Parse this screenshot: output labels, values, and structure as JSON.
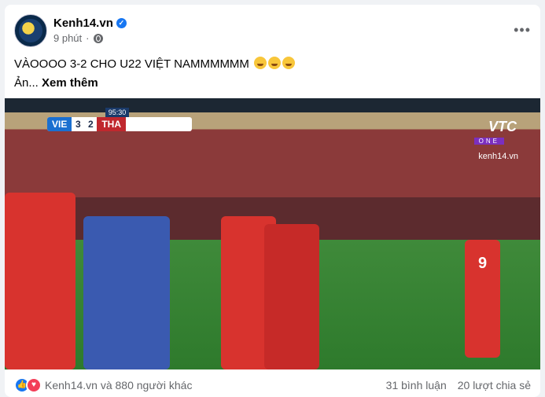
{
  "post": {
    "page_name": "Kenh14.vn",
    "time": "9 phút",
    "text": "VÀOOOO 3-2 CHO U22 VIỆT NAMMMMMM",
    "text_second": "Ản...",
    "see_more": "Xem thêm"
  },
  "scoreboard": {
    "clock": "95:30",
    "home": "VIE",
    "home_score": "3",
    "away_score": "2",
    "away": "THA"
  },
  "broadcast": {
    "logo": "VTC",
    "logo_sub": "ONE",
    "watermark": "kenh14.vn",
    "shirt_number": "9"
  },
  "footer": {
    "reactions_text": "Kenh14.vn và 880 người khác",
    "comments": "31 bình luận",
    "shares": "20 lượt chia sẻ"
  },
  "icons": [
    "verified-icon",
    "globe-icon",
    "more-icon",
    "like-icon",
    "love-icon"
  ]
}
